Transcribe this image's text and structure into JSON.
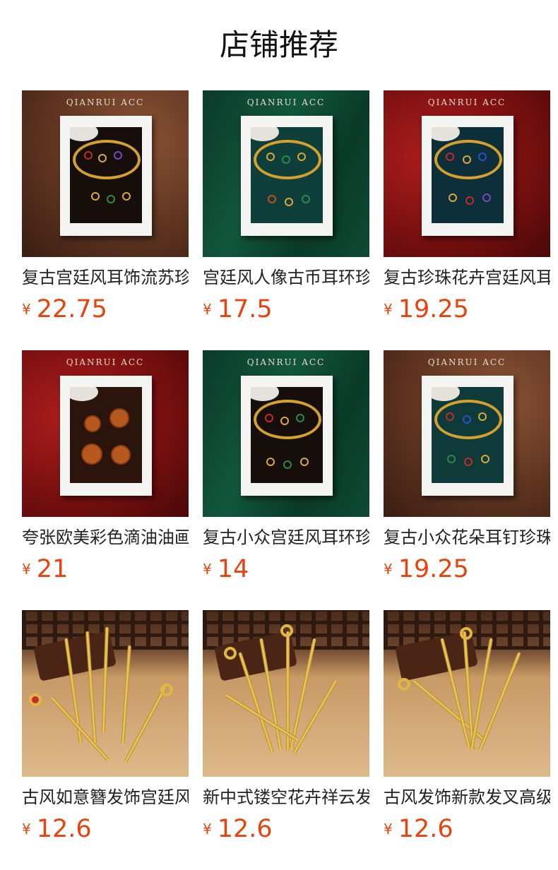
{
  "page": {
    "title": "店铺推荐"
  },
  "products": [
    {
      "brand": "QIANRUI  ACC",
      "name": "复古宫廷风耳饰流苏珍珠",
      "currency": "¥",
      "price": "22.75",
      "bg_color": "#5e3420"
    },
    {
      "brand": "QIANRUI  ACC",
      "name": "宫廷风人像古币耳环珍珠",
      "currency": "¥",
      "price": "17.5",
      "bg_color": "#11563d"
    },
    {
      "brand": "QIANRUI  ACC",
      "name": "复古珍珠花卉宫廷风耳饰",
      "currency": "¥",
      "price": "19.25",
      "bg_color": "#7a1010"
    },
    {
      "brand": "QIANRUI  ACC",
      "name": "夸张欧美彩色滴油油画耳",
      "currency": "¥",
      "price": "21",
      "bg_color": "#7a1010"
    },
    {
      "brand": "QIANRUI  ACC",
      "name": "复古小众宫廷风耳环珍珠",
      "currency": "¥",
      "price": "14",
      "bg_color": "#11563d"
    },
    {
      "brand": "QIANRUI  ACC",
      "name": "复古小众花朵耳钉珍珠耳",
      "currency": "¥",
      "price": "19.25",
      "bg_color": "#5e3420"
    },
    {
      "name": "古风如意簪发饰宫廷风",
      "currency": "¥",
      "price": "12.6"
    },
    {
      "name": "新中式镂空花卉祥云发簪",
      "currency": "¥",
      "price": "12.6"
    },
    {
      "name": "古风发饰新款发叉高级感",
      "currency": "¥",
      "price": "12.6"
    }
  ],
  "colors": {
    "price": "#e8430f",
    "title": "#111111"
  }
}
